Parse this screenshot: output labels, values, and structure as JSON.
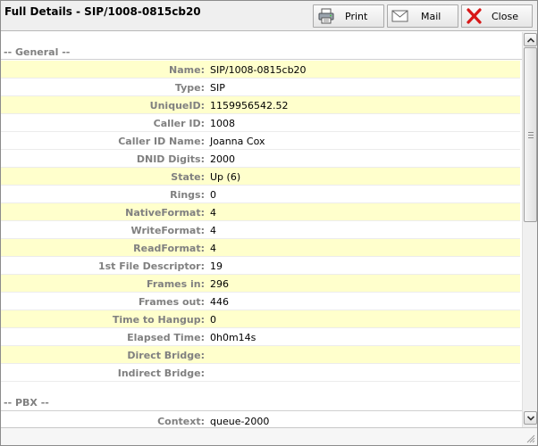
{
  "window": {
    "title": "Full Details - SIP/1008-0815cb20"
  },
  "toolbar": {
    "print_label": "Print",
    "mail_label": "Mail",
    "close_label": "Close",
    "print_icon": "printer-icon",
    "mail_icon": "envelope-icon",
    "close_icon": "red-x-icon"
  },
  "sections": {
    "general": {
      "header": "-- General --",
      "rows": [
        {
          "key": "Name:",
          "value": "SIP/1008-0815cb20"
        },
        {
          "key": "Type:",
          "value": "SIP"
        },
        {
          "key": "UniqueID:",
          "value": "1159956542.52"
        },
        {
          "key": "Caller ID:",
          "value": "1008"
        },
        {
          "key": "Caller ID Name:",
          "value": "Joanna Cox"
        },
        {
          "key": "DNID Digits:",
          "value": "2000"
        },
        {
          "key": "State:",
          "value": "Up (6)"
        },
        {
          "key": "Rings:",
          "value": "0"
        },
        {
          "key": "NativeFormat:",
          "value": "4"
        },
        {
          "key": "WriteFormat:",
          "value": "4"
        },
        {
          "key": "ReadFormat:",
          "value": "4"
        },
        {
          "key": "1st File Descriptor:",
          "value": "19"
        },
        {
          "key": "Frames in:",
          "value": "296"
        },
        {
          "key": "Frames out:",
          "value": "446"
        },
        {
          "key": "Time to Hangup:",
          "value": "0"
        },
        {
          "key": "Elapsed Time:",
          "value": "0h0m14s"
        },
        {
          "key": "Direct Bridge:",
          "value": ""
        },
        {
          "key": "Indirect Bridge:",
          "value": ""
        }
      ]
    },
    "pbx": {
      "header": "-- PBX --",
      "rows": [
        {
          "key": "Context:",
          "value": "queue-2000"
        }
      ]
    }
  },
  "colors": {
    "row_highlight": "#ffffcc",
    "label_gray": "#808080",
    "close_red": "#d81818"
  }
}
